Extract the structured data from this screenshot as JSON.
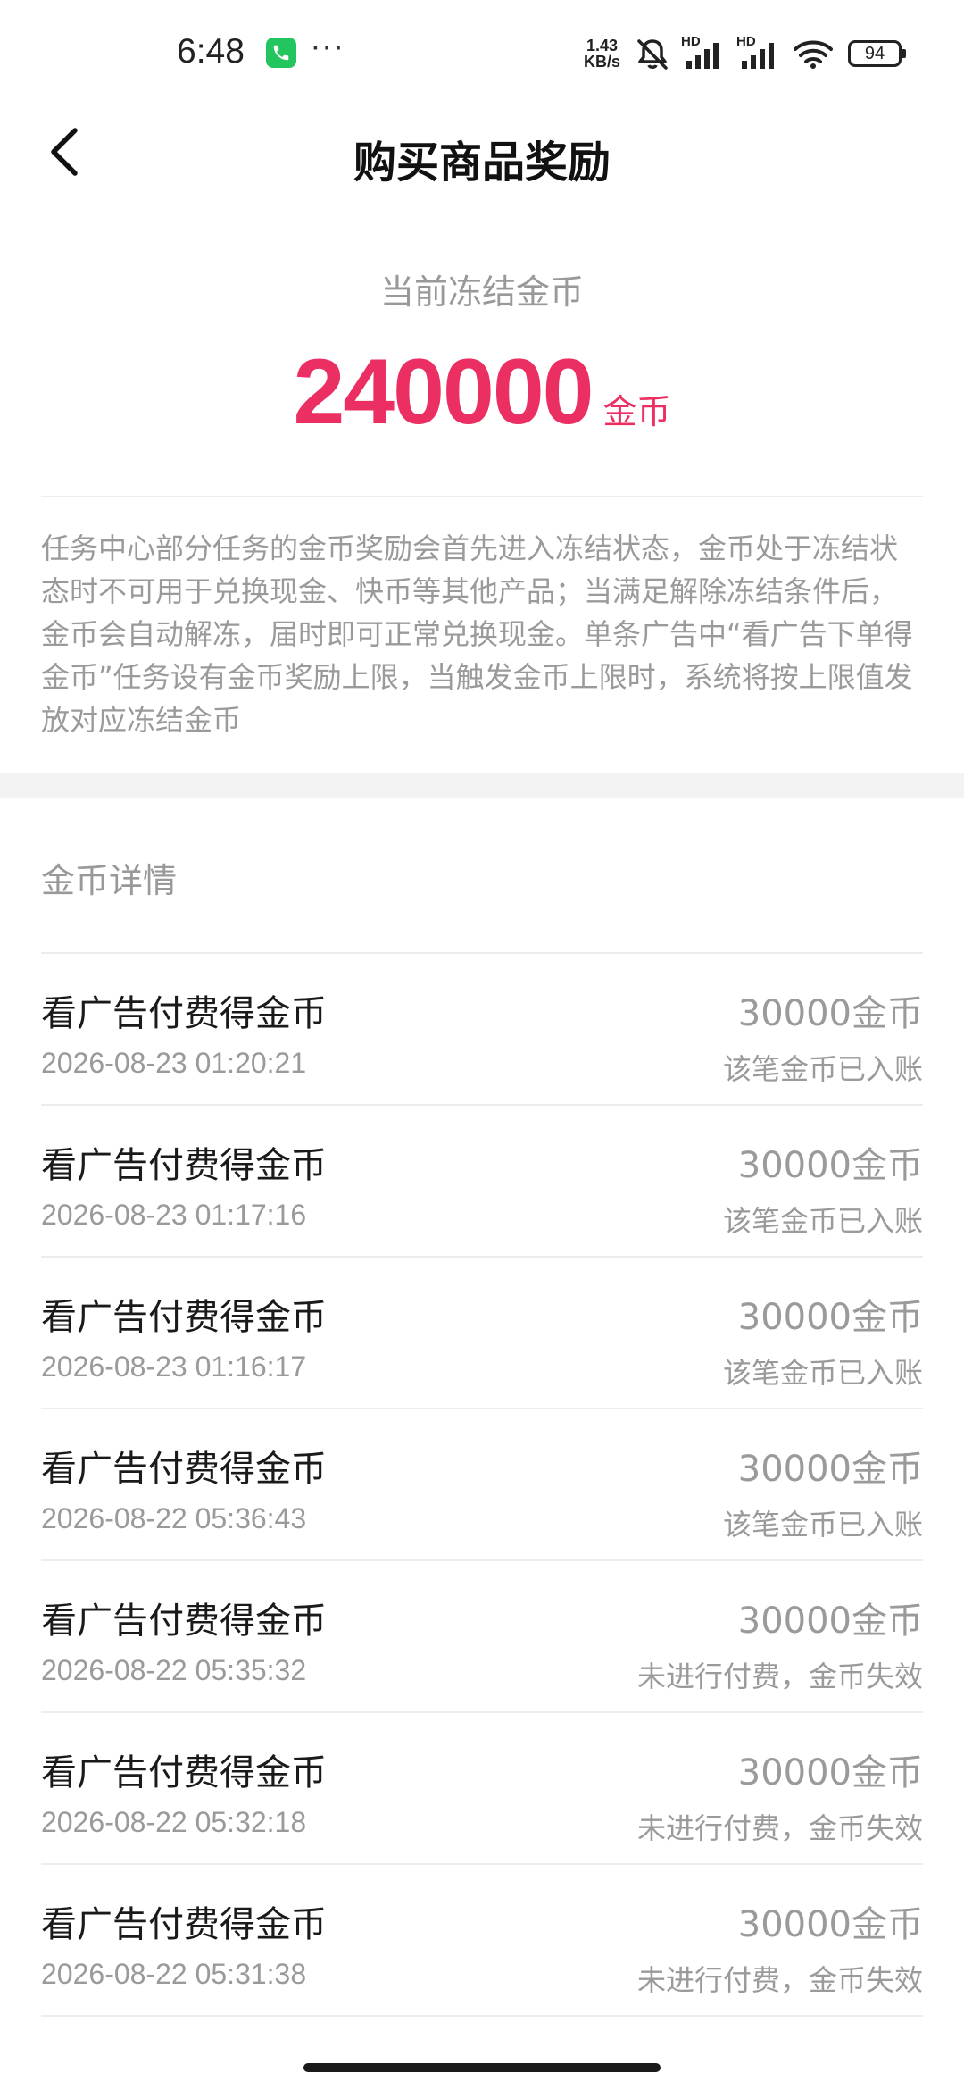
{
  "status_bar": {
    "time": "6:48",
    "dots": "···",
    "net_speed_value": "1.43",
    "net_speed_unit": "KB/s",
    "signal_label_1": "HD",
    "signal_label_2": "HD",
    "battery": "94"
  },
  "header": {
    "title": "购买商品奖励"
  },
  "summary": {
    "label": "当前冻结金币",
    "amount": "240000",
    "unit": "金币",
    "description": "任务中心部分任务的金币奖励会首先进入冻结状态，金币处于冻结状态时不可用于兑换现金、快币等其他产品；当满足解除冻结条件后，金币会自动解冻，届时即可正常兑换现金。单条广告中“看广告下单得金币”任务设有金币奖励上限，当触发金币上限时，系统将按上限值发放对应冻结金币"
  },
  "details": {
    "title": "金币详情",
    "rows": [
      {
        "title": "看广告付费得金币",
        "time": "2026-08-23 01:20:21",
        "amount": "30000金币",
        "status": "该笔金币已入账"
      },
      {
        "title": "看广告付费得金币",
        "time": "2026-08-23 01:17:16",
        "amount": "30000金币",
        "status": "该笔金币已入账"
      },
      {
        "title": "看广告付费得金币",
        "time": "2026-08-23 01:16:17",
        "amount": "30000金币",
        "status": "该笔金币已入账"
      },
      {
        "title": "看广告付费得金币",
        "time": "2026-08-22 05:36:43",
        "amount": "30000金币",
        "status": "该笔金币已入账"
      },
      {
        "title": "看广告付费得金币",
        "time": "2026-08-22 05:35:32",
        "amount": "30000金币",
        "status": "未进行付费，金币失效"
      },
      {
        "title": "看广告付费得金币",
        "time": "2026-08-22 05:32:18",
        "amount": "30000金币",
        "status": "未进行付费，金币失效"
      },
      {
        "title": "看广告付费得金币",
        "time": "2026-08-22 05:31:38",
        "amount": "30000金币",
        "status": "未进行付费，金币失效"
      }
    ]
  },
  "colors": {
    "accent": "#ec2f62",
    "muted_text": "#9a9a9a",
    "primary_text": "#1a1a1a",
    "call_icon": "#22c55e"
  },
  "icons": {
    "back": "chevron-left-icon",
    "call": "phone-icon",
    "mute": "bell-off-icon",
    "signal": "signal-bars-icon",
    "wifi": "wifi-icon",
    "battery": "battery-icon"
  }
}
